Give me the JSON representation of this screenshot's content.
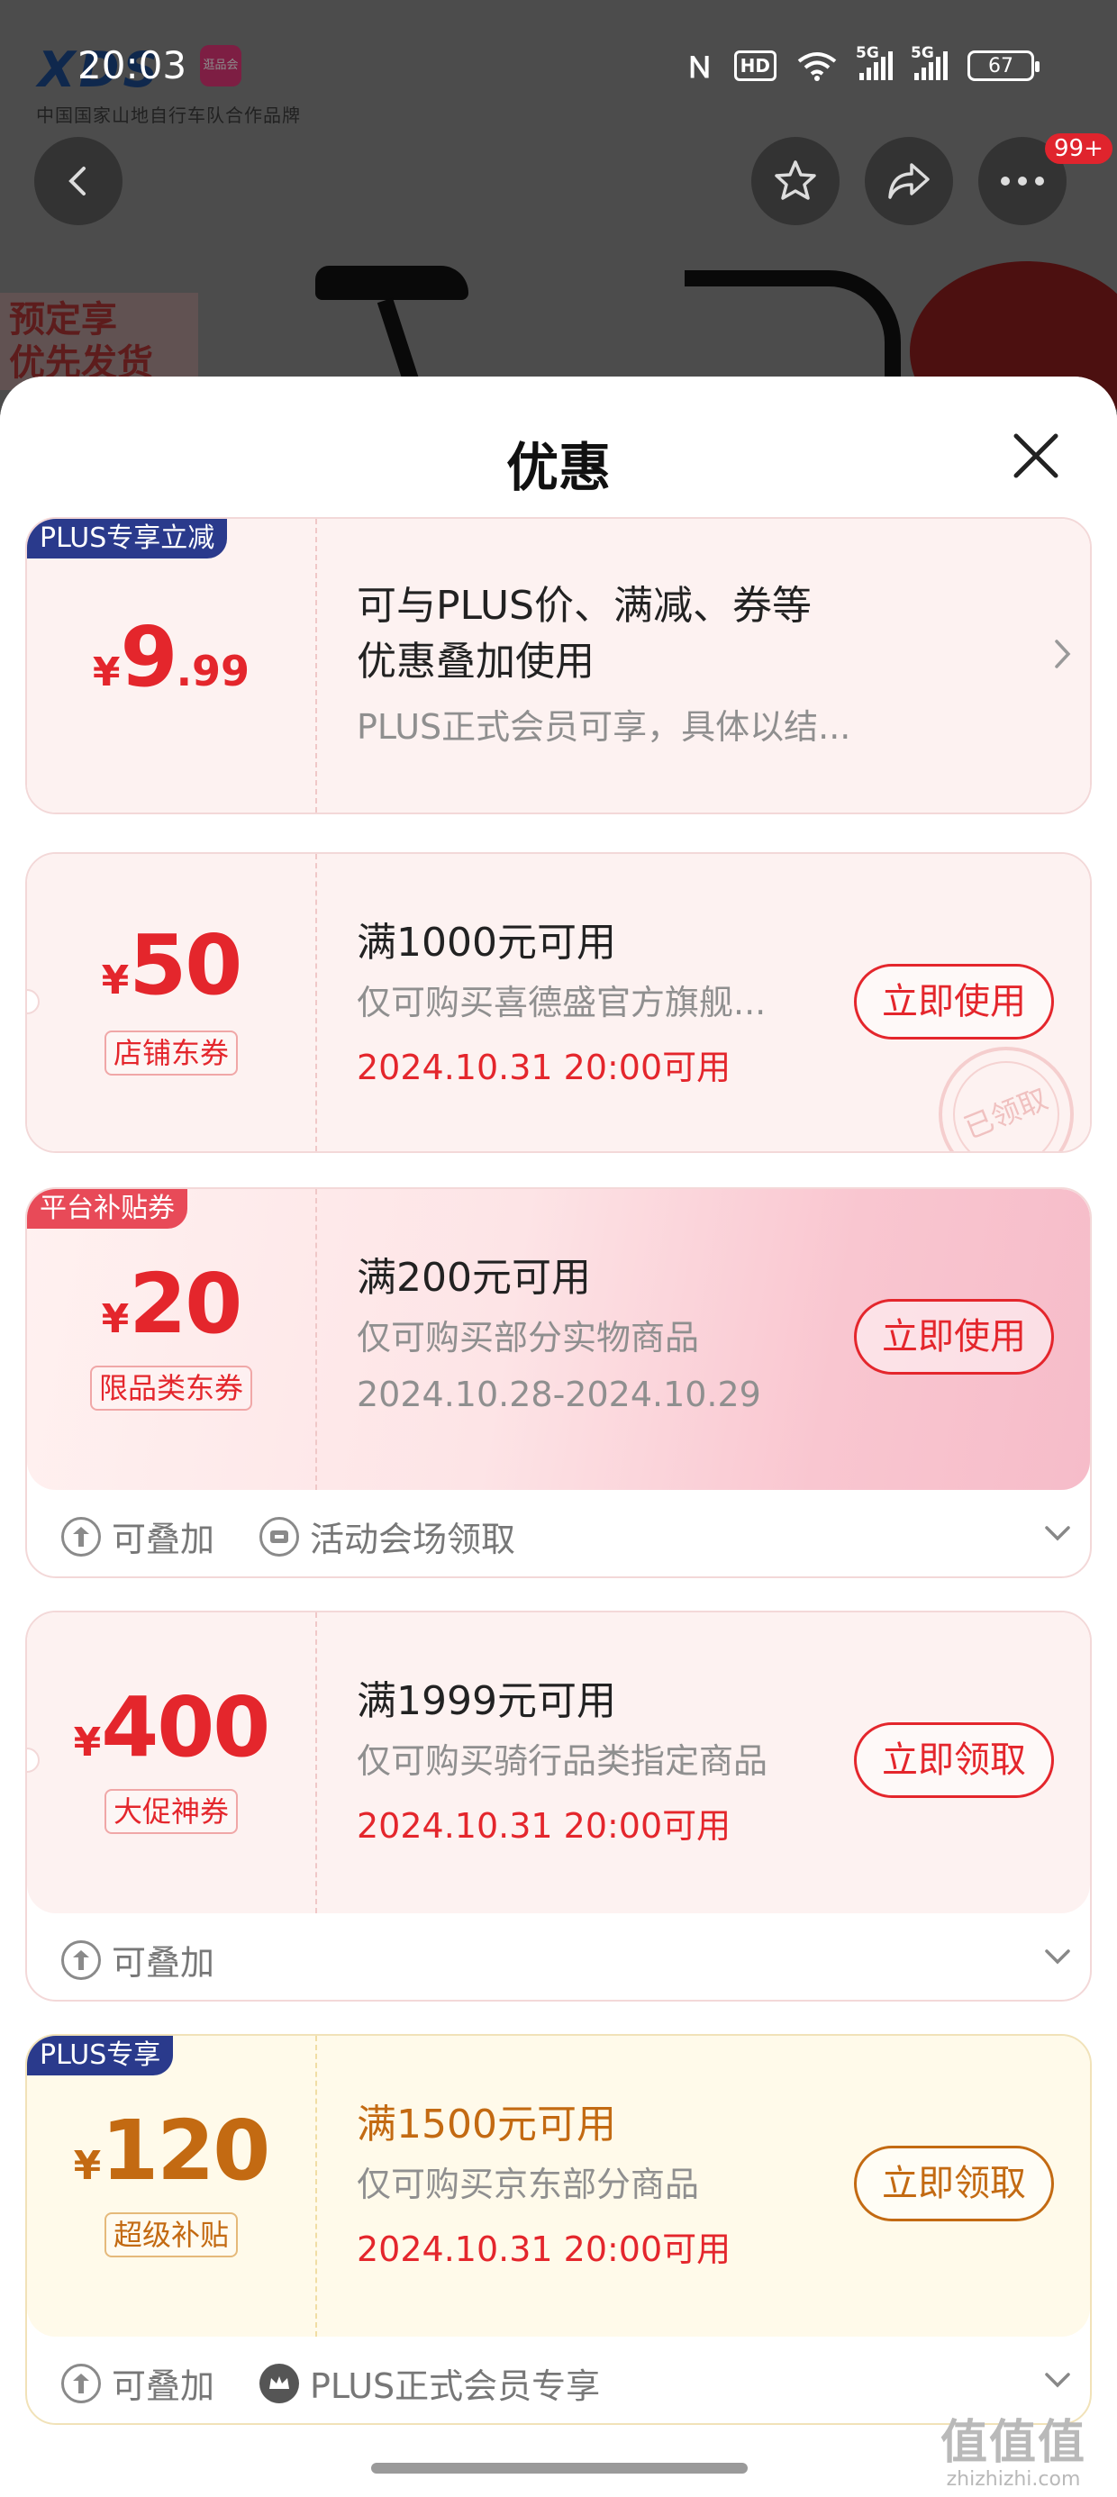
{
  "status_bar": {
    "time": "20:03",
    "network_1": "5G",
    "network_2": "5G",
    "battery": "67",
    "hd_label": "HD"
  },
  "background": {
    "brand_tagline": "中国国家山地自行车队合作品牌",
    "festival_badge": "逛品会",
    "presale_line1": "预定享",
    "presale_line2": "优先发货",
    "more_badge": "99+"
  },
  "sheet": {
    "title": "优惠"
  },
  "coupons": [
    {
      "tag": "PLUS专享立减",
      "currency": "¥",
      "amount": "9",
      "decimal": ".99",
      "condition_line1": "可与PLUS价、满减、券等",
      "condition_line2": "优惠叠加使用",
      "description": "PLUS正式会员可享，具体以结..."
    },
    {
      "currency": "¥",
      "amount": "50",
      "type": "店铺东券",
      "condition": "满1000元可用",
      "description": "仅可购买喜德盛官方旗舰...",
      "date": "2024.10.31 20:00可用",
      "button": "立即使用",
      "stamp": "已领取"
    },
    {
      "tag": "平台补贴券",
      "currency": "¥",
      "amount": "20",
      "type": "限品类东券",
      "condition": "满200元可用",
      "description": "仅可购买部分实物商品",
      "date": "2024.10.28-2024.10.29",
      "button": "立即使用",
      "footer": [
        "可叠加",
        "活动会场领取"
      ]
    },
    {
      "currency": "¥",
      "amount": "400",
      "type": "大促神券",
      "condition": "满1999元可用",
      "description": "仅可购买骑行品类指定商品",
      "date": "2024.10.31 20:00可用",
      "button": "立即领取",
      "footer": [
        "可叠加"
      ]
    },
    {
      "tag": "PLUS专享",
      "currency": "¥",
      "amount": "120",
      "type": "超级补贴",
      "condition": "满1500元可用",
      "description": "仅可购买京东部分商品",
      "date": "2024.10.31 20:00可用",
      "button": "立即领取",
      "footer": [
        "可叠加",
        "PLUS正式会员专享"
      ]
    }
  ],
  "watermark": {
    "line1": "值值值",
    "line2": "zhizhizhi.com"
  },
  "colors": {
    "accent_red": "#e4262c",
    "plus_blue": "#2a3a8c",
    "gold": "#c36a12"
  }
}
